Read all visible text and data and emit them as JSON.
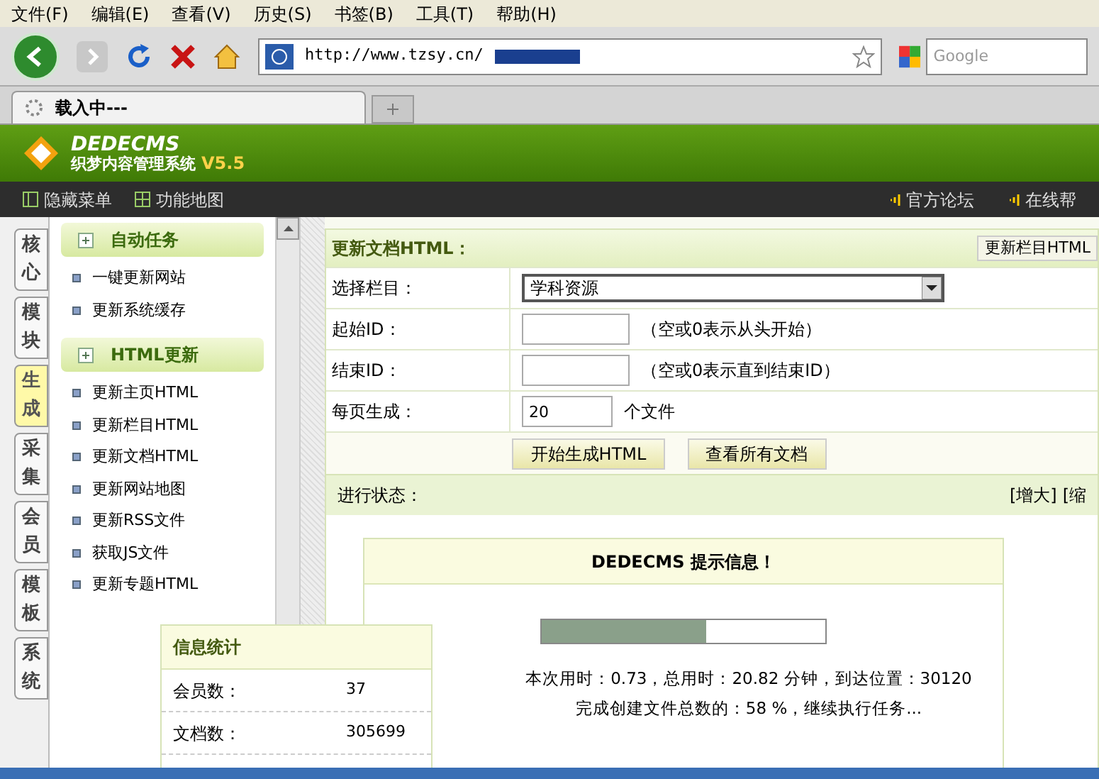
{
  "menu_bar": [
    "文件(F)",
    "编辑(E)",
    "查看(V)",
    "历史(S)",
    "书签(B)",
    "工具(T)",
    "帮助(H)"
  ],
  "address_bar": {
    "url": "http://www.tzsy.cn/"
  },
  "search_field": {
    "placeholder": "Google"
  },
  "browser_tab": {
    "title": "载入中---"
  },
  "header": {
    "logo": "DEDECMS",
    "subtitle": "织梦内容管理系统",
    "version": "V5.5"
  },
  "top_nav": {
    "left": [
      "隐藏菜单",
      "功能地图"
    ],
    "right": [
      "官方论坛",
      "在线帮"
    ]
  },
  "side_tabs": [
    {
      "label": "核心",
      "selected": false
    },
    {
      "label": "模块",
      "selected": false
    },
    {
      "label": "生成",
      "selected": true
    },
    {
      "label": "采集",
      "selected": false
    },
    {
      "label": "会员",
      "selected": false
    },
    {
      "label": "模板",
      "selected": false
    },
    {
      "label": "系统",
      "selected": false
    }
  ],
  "menu_groups": [
    {
      "title": "自动任务",
      "items": [
        "一键更新网站",
        "更新系统缓存"
      ]
    },
    {
      "title": "HTML更新",
      "items": [
        "更新主页HTML",
        "更新栏目HTML",
        "更新文档HTML",
        "更新网站地图",
        "更新RSS文件",
        "获取JS文件",
        "更新专题HTML"
      ]
    }
  ],
  "form": {
    "title": "更新文档HTML：",
    "corner_button": "更新栏目HTML",
    "rows": [
      {
        "kind": "select",
        "label": "选择栏目：",
        "value": "学科资源"
      },
      {
        "kind": "input",
        "label": "起始ID：",
        "value": "",
        "hint": "（空或0表示从头开始）"
      },
      {
        "kind": "input",
        "label": "结束ID：",
        "value": "",
        "hint": "（空或0表示直到结束ID）"
      },
      {
        "kind": "small",
        "label": "每页生成：",
        "value": "20",
        "hint": "个文件"
      }
    ],
    "buttons": [
      "开始生成HTML",
      "查看所有文档"
    ]
  },
  "status": {
    "label": "进行状态：",
    "links": [
      "[增大]",
      "[缩"
    ]
  },
  "message": {
    "title": "DEDECMS 提示信息！",
    "level": 0.58,
    "lines": [
      "本次用时：0.73，总用时：20.82 分钟，到达位置：30120",
      "完成创建文件总数的：58 %，继续执行任务..."
    ]
  },
  "stats": {
    "title": "信息统计",
    "rows": [
      {
        "label": "会员数：",
        "value": "37"
      },
      {
        "label": "文档数：",
        "value": "305699"
      }
    ]
  }
}
